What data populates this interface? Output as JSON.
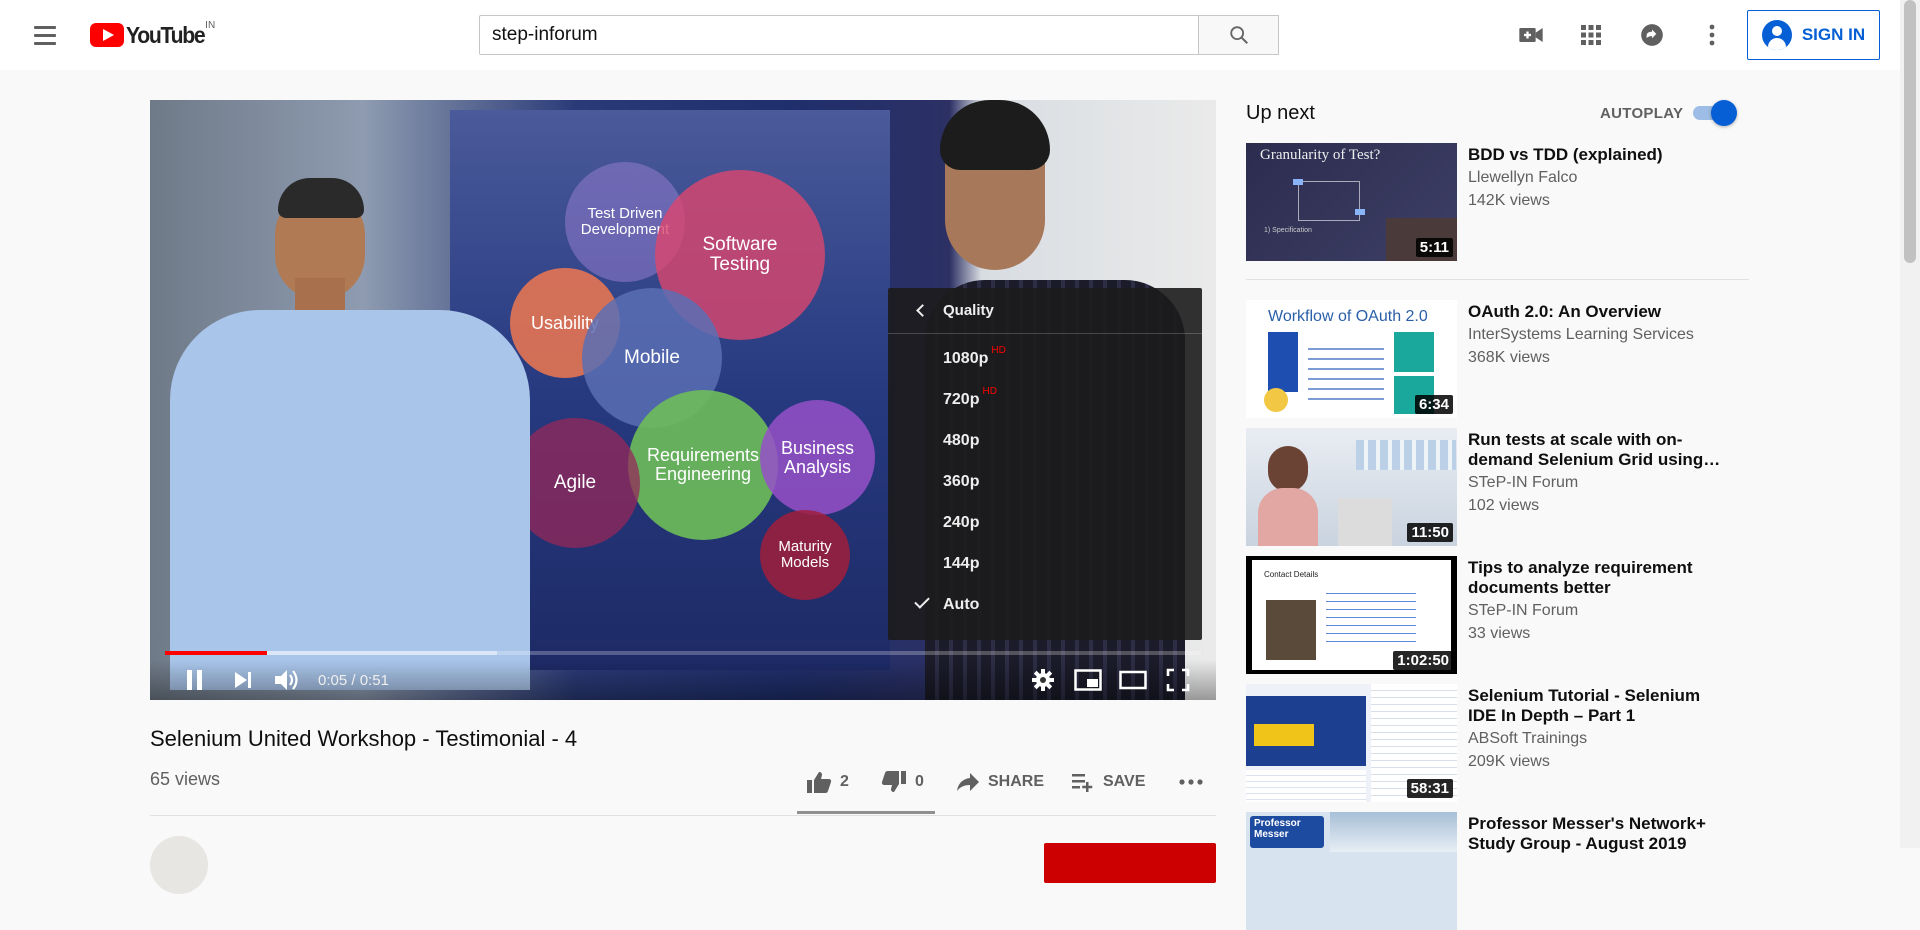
{
  "header": {
    "logo_text": "YouTube",
    "country": "IN",
    "search_value": "step-inforum",
    "signin_label": "SIGN IN",
    "icons": [
      "menu-icon",
      "search-icon",
      "create-video-icon",
      "apps-grid-icon",
      "messages-icon",
      "more-vert-icon",
      "account-circle-icon"
    ]
  },
  "player": {
    "current_time": "0:05",
    "duration": "0:51",
    "time_separator": " / ",
    "progress_played": 0.098,
    "progress_buffered": 0.32,
    "bubbles": {
      "tdd": "Test Driven\nDevelopment",
      "testing": "Software\nTesting",
      "usability": "Usability",
      "mobile": "Mobile",
      "requirements": "Requirements\nEngineering",
      "business": "Business\nAnalysis",
      "agile": "Agile",
      "maturity": "Maturity\nModels"
    },
    "quality_menu": {
      "title": "Quality",
      "options": [
        {
          "label": "1080p",
          "badge": "HD"
        },
        {
          "label": "720p",
          "badge": "HD"
        },
        {
          "label": "480p",
          "badge": ""
        },
        {
          "label": "360p",
          "badge": ""
        },
        {
          "label": "240p",
          "badge": ""
        },
        {
          "label": "144p",
          "badge": ""
        },
        {
          "label": "Auto",
          "badge": "",
          "selected": true
        }
      ]
    }
  },
  "video": {
    "title": "Selenium United Workshop - Testimonial - 4",
    "views": "65 views",
    "likes": "2",
    "dislikes": "0",
    "share_label": "SHARE",
    "save_label": "SAVE"
  },
  "sidebar": {
    "upnext_label": "Up next",
    "autoplay_label": "AUTOPLAY",
    "autoplay_on": true,
    "recommendations": [
      {
        "title": "BDD vs TDD (explained)",
        "channel": "Llewellyn Falco",
        "views": "142K views",
        "duration": "5:11",
        "thumb_text": "Granularity of Test?",
        "thumb_caption": "1) Specification"
      },
      {
        "title": "OAuth 2.0: An Overview",
        "channel": "InterSystems Learning Services",
        "views": "368K views",
        "duration": "6:34",
        "thumb_text": "Workflow of OAuth 2.0"
      },
      {
        "title": "Run tests at scale with on-demand Selenium Grid using…",
        "channel": "STeP-IN Forum",
        "views": "102 views",
        "duration": "11:50"
      },
      {
        "title": "Tips to analyze requirement documents better",
        "channel": "STeP-IN Forum",
        "views": "33 views",
        "duration": "1:02:50",
        "thumb_text": "Contact Details"
      },
      {
        "title": "Selenium Tutorial - Selenium IDE In Depth – Part 1",
        "channel": "ABSoft Trainings",
        "views": "209K views",
        "duration": "58:31"
      },
      {
        "title": "Professor Messer's Network+ Study Group - August 2019",
        "channel": "",
        "views": "",
        "duration": "",
        "thumb_text": "Professor Messer"
      }
    ]
  },
  "colors": {
    "brand_red": "#ff0000",
    "accent_blue": "#065fd4",
    "hd_red": "#ff0000"
  }
}
